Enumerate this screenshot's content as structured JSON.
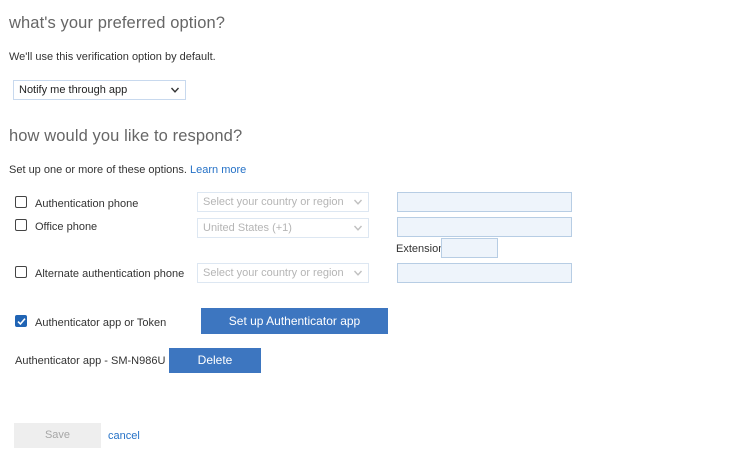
{
  "preferred": {
    "heading": "what's your preferred option?",
    "description": "We'll use this verification option by default.",
    "selected_option": "Notify me through app"
  },
  "respond": {
    "heading": "how would you like to respond?",
    "description": "Set up one or more of these options.",
    "learn_more": "Learn more"
  },
  "methods": {
    "auth_phone": {
      "label": "Authentication phone",
      "checked": false,
      "country_placeholder": "Select your country or region",
      "number": ""
    },
    "office_phone": {
      "label": "Office phone",
      "checked": false,
      "country_value": "United States (+1)",
      "number": "",
      "extension_label": "Extension",
      "extension": ""
    },
    "alt_phone": {
      "label": "Alternate authentication phone",
      "checked": false,
      "country_placeholder": "Select your country or region",
      "number": ""
    },
    "app": {
      "label": "Authenticator app or Token",
      "checked": true,
      "setup_button": "Set up Authenticator app"
    }
  },
  "device": {
    "label": "Authenticator app - SM-N986U",
    "delete_button": "Delete"
  },
  "footer": {
    "save": "Save",
    "cancel": "cancel"
  },
  "colors": {
    "accent": "#3d76c0",
    "link": "#2672c7",
    "heading": "#666666"
  }
}
